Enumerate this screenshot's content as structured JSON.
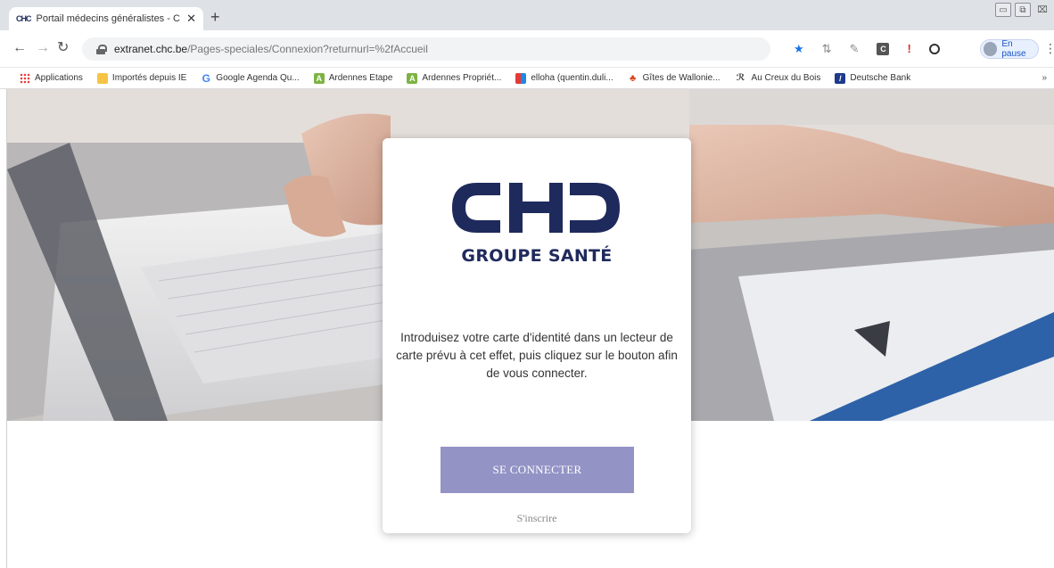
{
  "browser": {
    "tab_title": "Portail médecins généralistes - C",
    "tab_favicon": "CHC",
    "new_tab": "+",
    "url_domain": "extranet.chc.be",
    "url_path": "/Pages-speciales/Connexion?returnurl=%2fAccueil",
    "profile_status": "En pause",
    "bookmarks": [
      {
        "label": "Applications",
        "icon": "apps-grid-icon"
      },
      {
        "label": "Importés depuis IE",
        "icon": "folder-icon"
      },
      {
        "label": "Google Agenda Qu...",
        "icon": "google-icon"
      },
      {
        "label": "Ardennes Etape",
        "icon": "ardennes-icon"
      },
      {
        "label": "Ardennes Propriét...",
        "icon": "ardennes-icon"
      },
      {
        "label": "elloha (quentin.duli...",
        "icon": "elloha-icon"
      },
      {
        "label": "Gîtes de Wallonie...",
        "icon": "gites-icon"
      },
      {
        "label": "Au Creux du Bois",
        "icon": "creux-icon"
      },
      {
        "label": "Deutsche Bank",
        "icon": "deutsche-bank-icon"
      }
    ],
    "bookmarks_more": "»"
  },
  "brand": {
    "logo_text": "CHC",
    "logo_subtitle": "GROUPE SANTÉ",
    "color": "#1f2a5c"
  },
  "login": {
    "instructions": "Introduisez votre carte d'identité dans un lecteur de carte prévu à cet effet, puis cliquez sur le bouton afin de vous connecter.",
    "connect_label": "SE CONNECTER",
    "register_label": "S'inscrire",
    "button_color": "#9393c6"
  }
}
